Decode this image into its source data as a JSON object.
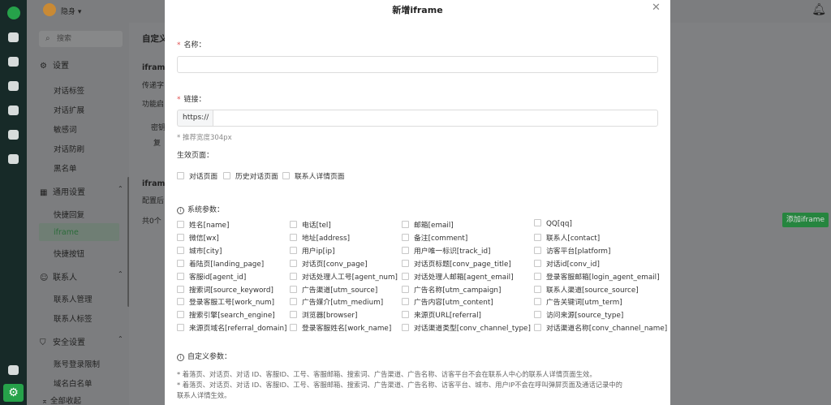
{
  "topbar": {
    "username": "隐身",
    "dropdown_icon": "caret-down-icon"
  },
  "sidebar": {
    "search_placeholder": "搜索",
    "settings_label": "设置",
    "items_top": [
      "对话标签",
      "对话扩展",
      "敏感词",
      "对话防刷",
      "黑名单"
    ],
    "group_general": "通用设置",
    "items_general": [
      "快捷回复",
      "iframe",
      "快捷按钮"
    ],
    "group_contact": "联系人",
    "items_contact": [
      "联系人管理",
      "联系人标签"
    ],
    "group_security": "安全设置",
    "items_security": [
      "账号登录限制",
      "域名白名单"
    ],
    "collapse_all": "全部收起"
  },
  "content": {
    "custom_title": "自定义",
    "iframe_label_1": "ifram",
    "desc_1": "传递字",
    "func_label": "功能启",
    "key_label": "密钥",
    "copy_label": "复",
    "iframe_label_2": "ifram",
    "desc_2": "配置后",
    "count_label": "共0个",
    "add_button": "添加iframe"
  },
  "modal": {
    "title": "新增iframe",
    "name_label": "名称：",
    "link_label": "链接：",
    "link_prefix": "https://",
    "width_hint": "* 推荐宽度304px",
    "effective_pages_label": "生效页面：",
    "pages": [
      "对话页面",
      "历史对话页面",
      "联系人详情页面"
    ],
    "system_params_label": "系统参数：",
    "system_params": [
      [
        "姓名[name]",
        "电话[tel]",
        "邮箱[email]",
        "QQ[qq]"
      ],
      [
        "微信[wx]",
        "地址[address]",
        "备注[comment]",
        "联系人[contact]"
      ],
      [
        "城市[city]",
        "用户ip[ip]",
        "用户唯一标识[track_id]",
        "访客平台[platform]"
      ],
      [
        "着陆页[landing_page]",
        "对话页[conv_page]",
        "对话页标题[conv_page_title]",
        "对话id[conv_id]"
      ],
      [
        "客服id[agent_id]",
        "对话处理人工号[agent_num]",
        "对话处理人邮箱[agent_email]",
        "登录客服邮箱[login_agent_email]"
      ],
      [
        "搜索词[source_keyword]",
        "广告渠道[utm_source]",
        "广告名称[utm_campaign]",
        "联系人渠道[source_source]"
      ],
      [
        "登录客服工号[work_num]",
        "广告媒介[utm_medium]",
        "广告内容[utm_content]",
        "广告关键词[utm_term]"
      ],
      [
        "搜索引擎[search_engine]",
        "浏览器[browser]",
        "来源页URL[referral]",
        "访问来源[source_type]"
      ],
      [
        "来源页域名[referral_domain]",
        "登录客服姓名[work_name]",
        "对话渠道类型[conv_channel_type]",
        "对话渠道名称[conv_channel_name]"
      ]
    ],
    "custom_params_label": "自定义参数：",
    "note_1": "* 着落页、对话页、对话 ID、客服ID、工号、客服邮箱、搜索词、广告渠道、广告名称、访客平台不会在联系人中心的联系人详情页面生效。",
    "note_2a": "* 着落页、对话页、对话 ID、客服ID、工号、客服邮箱、搜索词、广告渠道、广告名称、访客平台、城市、用户IP不会在呼叫弹屏页面及通话记录中的",
    "note_2b": "联系人详情生效。"
  },
  "colors": {
    "accent": "#26a24a",
    "required": "#e05050",
    "overlay": "#7f8082"
  }
}
